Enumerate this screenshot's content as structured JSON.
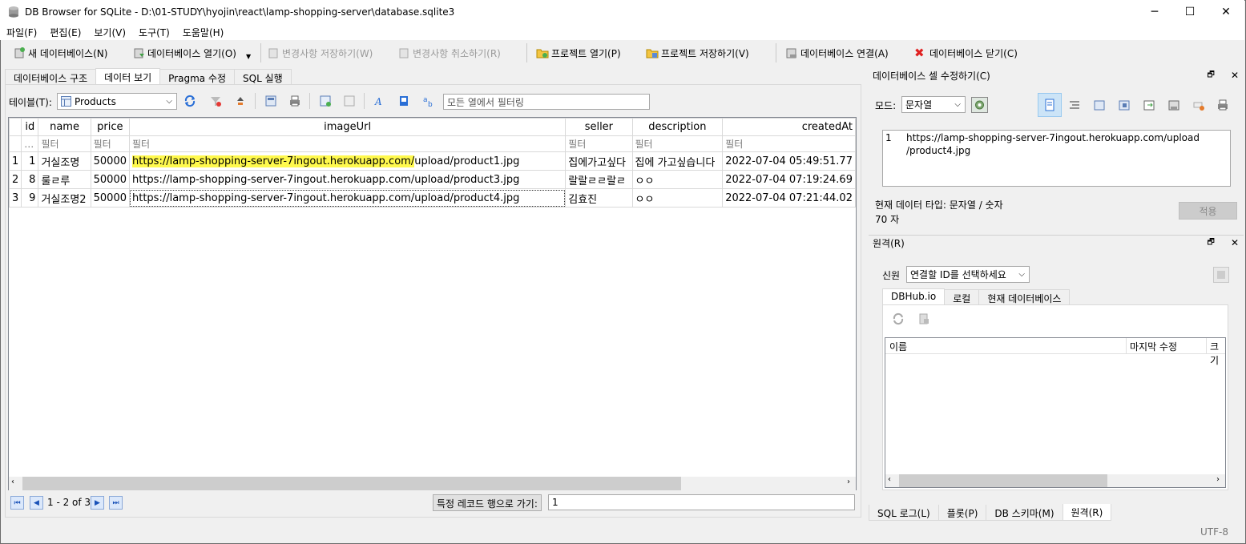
{
  "window": {
    "title": "DB Browser for SQLite - D:\\01-STUDY\\hyojin\\react\\lamp-shopping-server\\database.sqlite3",
    "minimize": "─",
    "maximize": "☐",
    "close": "✕"
  },
  "menu": [
    "파일(F)",
    "편집(E)",
    "보기(V)",
    "도구(T)",
    "도움말(H)"
  ],
  "toolbar": {
    "new_db": "새 데이터베이스(N)",
    "open_db": "데이터베이스 열기(O)",
    "write_changes": "변경사항 저장하기(W)",
    "revert_changes": "변경사항 취소하기(R)",
    "open_project": "프로젝트 열기(P)",
    "save_project": "프로젝트 저장하기(V)",
    "attach_db": "데이터베이스 연결(A)",
    "close_db": "데이터베이스 닫기(C)"
  },
  "main_tabs": [
    "데이터베이스 구조",
    "데이터 보기",
    "Pragma 수정",
    "SQL 실행"
  ],
  "browse": {
    "table_label": "테이블(T):",
    "table_value": "Products",
    "filter_placeholder": "모든 열에서 필터링",
    "columns": [
      "id",
      "name",
      "price",
      "imageUrl",
      "seller",
      "description",
      "createdAt"
    ],
    "filter_ellipsis": "…",
    "filter_label": "필터",
    "rows": [
      {
        "rownum": "1",
        "id": "1",
        "name": "거실조명",
        "price": "50000",
        "imageUrl_hl": "https://lamp-shopping-server-7ingout.herokuapp.com/",
        "imageUrl_rest": "upload/product1.jpg",
        "seller": "집에가고싶다",
        "description": "집에 가고싶습니다",
        "createdAt": "2022-07-04 05:49:51.77"
      },
      {
        "rownum": "2",
        "id": "8",
        "name": "룰ㄹ루",
        "price": "50000",
        "imageUrl_hl": "",
        "imageUrl_rest": "https://lamp-shopping-server-7ingout.herokuapp.com/upload/product3.jpg",
        "seller": "랄랄ㄹㄹ랄ㄹ",
        "description": "ㅇㅇ",
        "createdAt": "2022-07-04 07:19:24.69"
      },
      {
        "rownum": "3",
        "id": "9",
        "name": "거실조명2",
        "price": "50000",
        "imageUrl_hl": "",
        "imageUrl_rest": "https://lamp-shopping-server-7ingout.herokuapp.com/upload/product4.jpg",
        "seller": "김효진",
        "description": "ㅇㅇ",
        "createdAt": "2022-07-04 07:21:44.02"
      }
    ],
    "record_count": "1 - 2 of 3",
    "goto_label": "특정 레코드 행으로 가기:",
    "goto_value": "1"
  },
  "edit_cell": {
    "header": "데이터베이스 셀 수정하기(C)",
    "mode_label": "모드:",
    "mode_value": "문자열",
    "line_no": "1",
    "content_line1": "https://lamp-shopping-server-7ingout.herokuapp.com/upload",
    "content_line2": "/product4.jpg",
    "type_info": "현재 데이터 타입: 문자열 / 숫자",
    "size_info": "70 자",
    "apply": "적용"
  },
  "remote": {
    "header": "원격(R)",
    "identity_label": "신원",
    "identity_value": "연결할 ID를 선택하세요",
    "tabs": [
      "DBHub.io",
      "로컬",
      "현재 데이터베이스"
    ],
    "columns": [
      "이름",
      "마지막 수정",
      "크기"
    ]
  },
  "bottom_tabs": [
    "SQL 로그(L)",
    "플롯(P)",
    "DB 스키마(M)",
    "원격(R)"
  ],
  "status": {
    "encoding": "UTF-8"
  }
}
